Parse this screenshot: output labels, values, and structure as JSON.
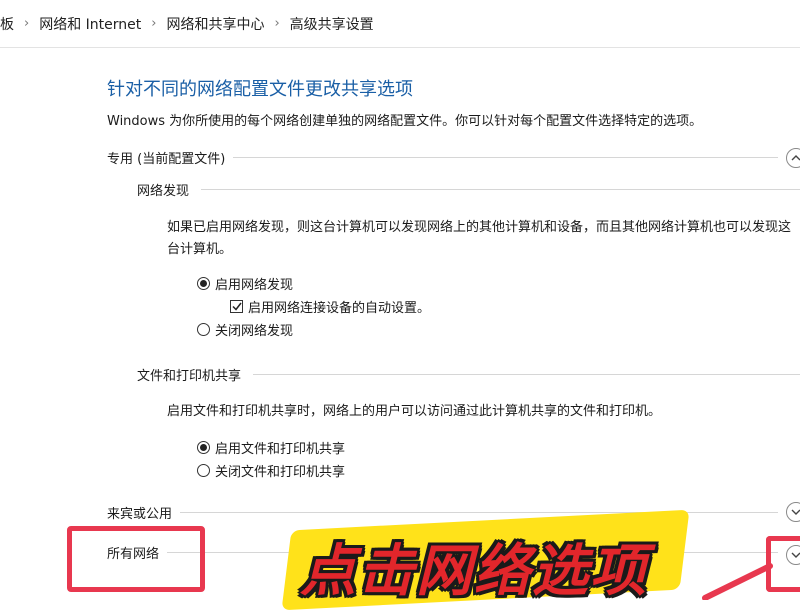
{
  "breadcrumb": [
    "板",
    "网络和 Internet",
    "网络和共享中心",
    "高级共享设置"
  ],
  "page": {
    "title": "针对不同的网络配置文件更改共享选项",
    "description": "Windows 为你所使用的每个网络创建单独的网络配置文件。你可以针对每个配置文件选择特定的选项。"
  },
  "private_profile": {
    "label": "专用 (当前配置文件)",
    "network_discovery": {
      "heading": "网络发现",
      "description": "如果已启用网络发现，则这台计算机可以发现网络上的其他计算机和设备，而且其他网络计算机也可以发现这台计算机。",
      "enable_label": "启用网络发现",
      "auto_setup_label": "启用网络连接设备的自动设置。",
      "disable_label": "关闭网络发现"
    },
    "file_printer_sharing": {
      "heading": "文件和打印机共享",
      "description": "启用文件和打印机共享时，网络上的用户可以访问通过此计算机共享的文件和打印机。",
      "enable_label": "启用文件和打印机共享",
      "disable_label": "关闭文件和打印机共享"
    }
  },
  "guest_public": {
    "label": "来宾或公用"
  },
  "all_networks": {
    "label": "所有网络"
  },
  "annotation": {
    "banner_text": "点击网络选项"
  },
  "colors": {
    "title": "#1a5fa6",
    "highlight": "#e8384f",
    "banner_fill": "#e2262b",
    "banner_bg": "#ffe21a"
  }
}
